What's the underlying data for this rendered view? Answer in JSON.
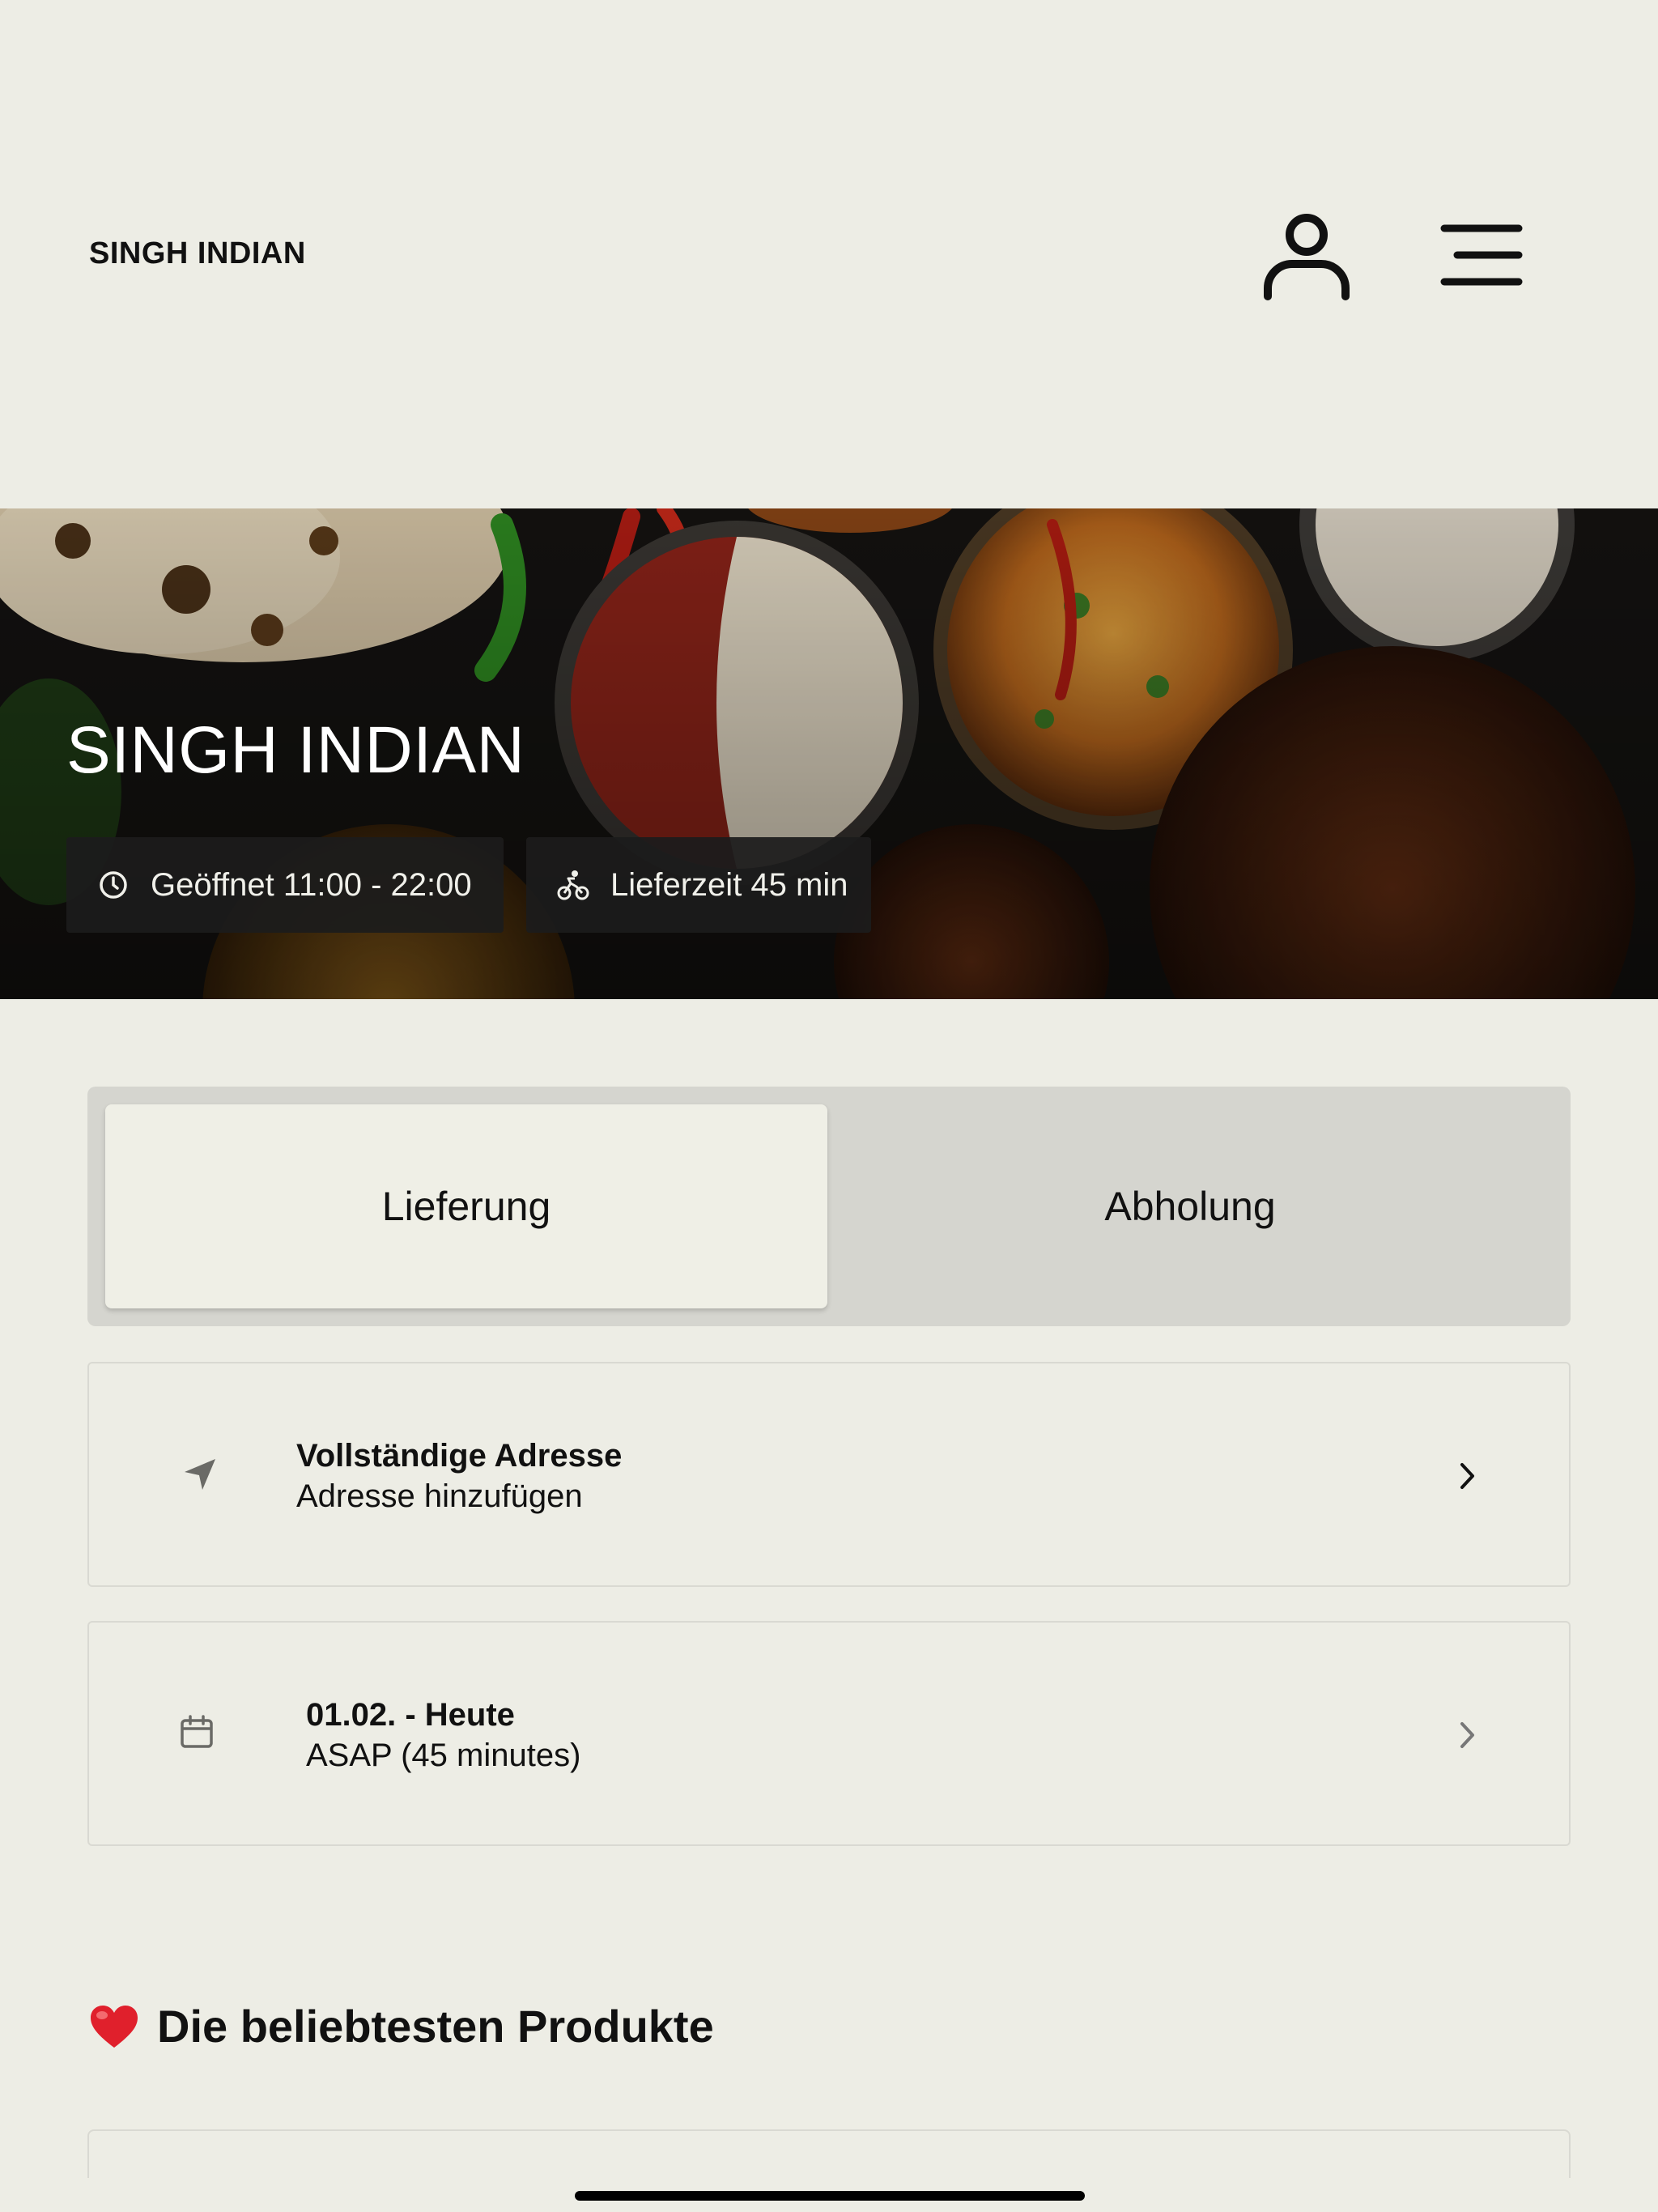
{
  "header": {
    "brand": "SINGH INDIAN",
    "user_icon": "user-icon",
    "menu_icon": "hamburger-menu-icon"
  },
  "hero": {
    "title": "SINGH INDIAN",
    "opening_hours": "Geöffnet 11:00 - 22:00",
    "delivery_time": "Lieferzeit 45 min",
    "opening_icon": "clock-icon",
    "delivery_icon": "bike-icon"
  },
  "order_mode": {
    "options": [
      "Lieferung",
      "Abholung"
    ],
    "selected": "Lieferung"
  },
  "address_card": {
    "title": "Vollständige Adresse",
    "subtitle": "Adresse hinzufügen",
    "icon": "location-arrow-icon"
  },
  "time_card": {
    "title": "01.02. - Heute",
    "subtitle": "ASAP (45 minutes)",
    "icon": "calendar-icon"
  },
  "popular": {
    "title": "Die beliebtesten Produkte",
    "icon": "heart-icon"
  },
  "colors": {
    "background": "#edede5",
    "segment_track": "#d5d5cf",
    "chip_background": "#1c1c1c",
    "heart": "#e0202c"
  }
}
